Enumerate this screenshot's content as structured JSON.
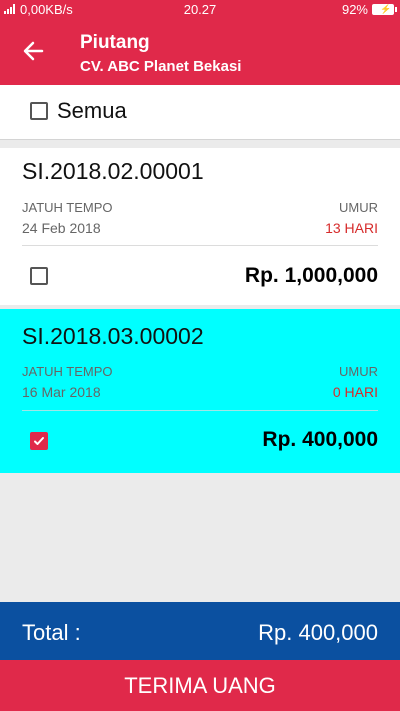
{
  "status_bar": {
    "network": "0,00KB/s",
    "time": "20.27",
    "battery": "92%"
  },
  "app_bar": {
    "title": "Piutang",
    "subtitle": "CV. ABC Planet Bekasi"
  },
  "select_all": {
    "label": "Semua",
    "checked": false
  },
  "invoices": [
    {
      "number": "SI.2018.02.00001",
      "due_label": "JATUH TEMPO",
      "due_date": "24 Feb 2018",
      "age_label": "UMUR",
      "age": "13 HARI",
      "amount": "Rp. 1,000,000",
      "checked": false,
      "highlight_color": "#ffffff"
    },
    {
      "number": "SI.2018.03.00002",
      "due_label": "JATUH TEMPO",
      "due_date": "16 Mar 2018",
      "age_label": "UMUR",
      "age": "0 HARI",
      "amount": "Rp. 400,000",
      "checked": true,
      "highlight_color": "#00ffff"
    }
  ],
  "total": {
    "label": "Total :",
    "value": "Rp. 400,000"
  },
  "action": {
    "label": "TERIMA UANG"
  },
  "colors": {
    "primary": "#e0294a",
    "total_bar": "#0b50a0",
    "age_text": "#d62b2b",
    "selected_card": "#00ffff"
  },
  "icons": [
    "signal-icon",
    "battery-icon",
    "back-arrow-icon",
    "checkbox-icon"
  ]
}
